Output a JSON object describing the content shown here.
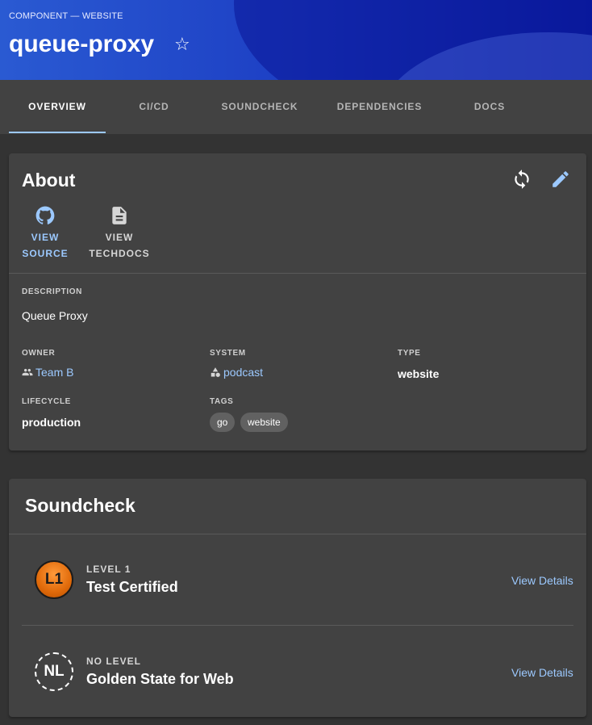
{
  "header": {
    "kind": "COMPONENT — WEBSITE",
    "title": "queue-proxy",
    "star_icon": "☆"
  },
  "tabs": [
    {
      "label": "OVERVIEW",
      "active": true
    },
    {
      "label": "CI/CD"
    },
    {
      "label": "SOUNDCHECK"
    },
    {
      "label": "DEPENDENCIES"
    },
    {
      "label": "DOCS"
    }
  ],
  "about": {
    "title": "About",
    "refresh_icon": "sync-icon",
    "edit_icon": "pencil-icon",
    "links": [
      {
        "line1": "VIEW",
        "line2": "SOURCE",
        "icon": "github-icon",
        "color": "#9cc9ff"
      },
      {
        "line1": "VIEW",
        "line2": "TECHDOCS",
        "icon": "document-icon",
        "color": "#d6d6d6"
      }
    ],
    "description_label": "DESCRIPTION",
    "description": "Queue Proxy",
    "owner_label": "OWNER",
    "owner": "Team B",
    "system_label": "SYSTEM",
    "system": "podcast",
    "type_label": "TYPE",
    "type": "website",
    "lifecycle_label": "LIFECYCLE",
    "lifecycle": "production",
    "tags_label": "TAGS",
    "tags": [
      "go",
      "website"
    ]
  },
  "soundcheck": {
    "title": "Soundcheck",
    "items": [
      {
        "badge": "L1",
        "level": "LEVEL 1",
        "name": "Test Certified",
        "action": "View Details",
        "badge_color": "#e8780f"
      },
      {
        "badge": "NL",
        "level": "NO LEVEL",
        "name": "Golden State for Web",
        "action": "View Details"
      }
    ]
  },
  "colors": {
    "accent": "#9cc9ff",
    "header_start": "#2a5ad2",
    "header_end": "#0b1ea3",
    "card": "#424242",
    "page": "#333333"
  }
}
